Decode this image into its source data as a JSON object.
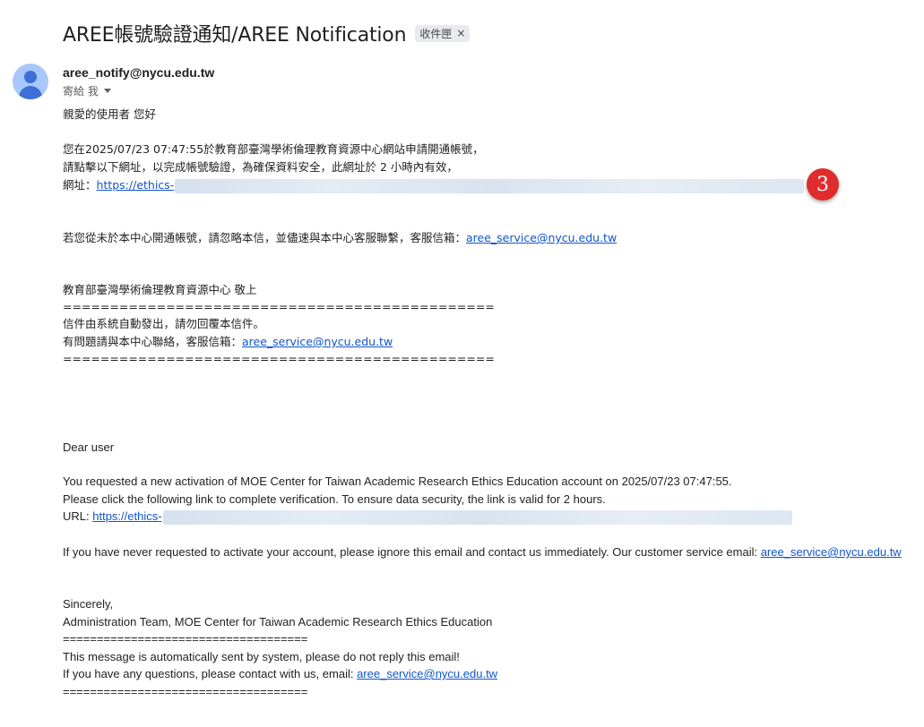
{
  "email": {
    "subject": "AREE帳號驗證通知/AREE Notification",
    "label": "收件匣",
    "label_remove": "×",
    "sender": "aree_notify@nycu.edu.tw",
    "to_me": "寄給 我",
    "avatar_icon": "person-avatar-icon"
  },
  "body_zh": {
    "greeting": "親愛的使用者 您好",
    "line1": "您在2025/07/23 07:47:55於教育部臺灣學術倫理教育資源中心網站申請開通帳號，",
    "line2": "請點擊以下網址，以完成帳號驗證，為確保資料安全，此網址於 2 小時內有效，",
    "url_prefix": "網址：",
    "url_visible": "https://ethics-",
    "ignore_text": "若您從未於本中心開通帳號，請忽略本信，並儘速與本中心客服聯繫，客服信箱：",
    "service_email": "aree_service@nycu.edu.tw",
    "signature": "教育部臺灣學術倫理教育資源中心 敬上",
    "separator": "==============================================",
    "auto_notice": "信件由系統自動發出，請勿回覆本信件。",
    "contact_text": "有問題請與本中心聯絡，客服信箱：",
    "contact_email": "aree_service@nycu.edu.tw",
    "separator2": "=============================================="
  },
  "body_en": {
    "greeting": "Dear user",
    "line1": "You requested a new activation of MOE Center for Taiwan Academic Research Ethics Education account on 2025/07/23 07:47:55.",
    "line2": "Please click the following link to complete verification. To ensure data security, the link is valid for 2 hours.",
    "url_prefix": "URL: ",
    "url_visible": "https://ethics-",
    "ignore_text": "If you have never requested to activate your account, please ignore this email and contact us immediately. Our customer service email: ",
    "service_email": "aree_service@nycu.edu.tw",
    "sincerely": "Sincerely,",
    "team": "Administration Team, MOE Center for Taiwan Academic Research Ethics Education",
    "separator": "====================================",
    "auto_notice": "This message is automatically sent by system, please do not reply this email!",
    "contact_text": "If you have any questions, please contact with us, email: ",
    "contact_email": "aree_service@nycu.edu.tw",
    "separator2": "===================================="
  },
  "annotation": {
    "badge_number": "3",
    "badge_color": "#e02c2c"
  },
  "colors": {
    "link": "#1155cc",
    "avatar_bg": "#a8c7fa",
    "avatar_fg": "#3d6fd6"
  }
}
